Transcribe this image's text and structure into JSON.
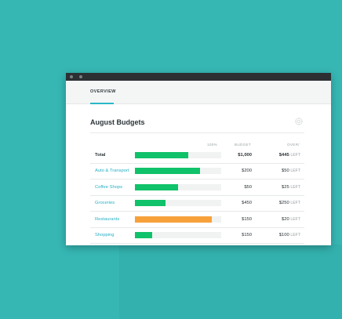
{
  "tab": {
    "label": "OVERVIEW"
  },
  "panel": {
    "title": "August Budgets"
  },
  "columns": {
    "percent": "100%",
    "budget": "BUDGET",
    "over": "OVER/"
  },
  "colors": {
    "background": "#36b7b4",
    "accent": "#2ab7c9",
    "bar_green": "#10c26a",
    "bar_orange": "#f7a13a"
  },
  "rows": [
    {
      "label": "Total",
      "budget": "$1,000",
      "left_amount": "$445",
      "left_suffix": "LEFT",
      "progress": 0.62,
      "status": "ok"
    },
    {
      "label": "Auto & Transport",
      "budget": "$200",
      "left_amount": "$50",
      "left_suffix": "LEFT",
      "progress": 0.75,
      "status": "ok"
    },
    {
      "label": "Coffee Shops",
      "budget": "$50",
      "left_amount": "$25",
      "left_suffix": "LEFT",
      "progress": 0.5,
      "status": "ok"
    },
    {
      "label": "Groceries",
      "budget": "$450",
      "left_amount": "$250",
      "left_suffix": "LEFT",
      "progress": 0.35,
      "status": "ok"
    },
    {
      "label": "Restaurants",
      "budget": "$150",
      "left_amount": "$20",
      "left_suffix": "LEFT",
      "progress": 0.89,
      "status": "warning"
    },
    {
      "label": "Shopping",
      "budget": "$150",
      "left_amount": "$100",
      "left_suffix": "LEFT",
      "progress": 0.2,
      "status": "ok"
    }
  ]
}
